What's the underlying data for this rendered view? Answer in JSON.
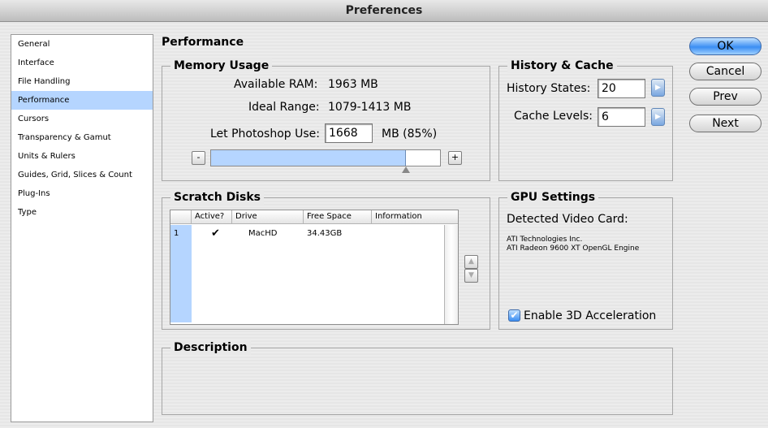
{
  "window": {
    "title": "Preferences"
  },
  "sidebar": {
    "items": [
      {
        "label": "General"
      },
      {
        "label": "Interface"
      },
      {
        "label": "File Handling"
      },
      {
        "label": "Performance"
      },
      {
        "label": "Cursors"
      },
      {
        "label": "Transparency & Gamut"
      },
      {
        "label": "Units & Rulers"
      },
      {
        "label": "Guides, Grid, Slices & Count"
      },
      {
        "label": "Plug-Ins"
      },
      {
        "label": "Type"
      }
    ],
    "selected": "Performance"
  },
  "page": {
    "title": "Performance"
  },
  "memory": {
    "title": "Memory Usage",
    "available_label": "Available RAM:",
    "available_value": "1963 MB",
    "ideal_label": "Ideal Range:",
    "ideal_value": "1079-1413 MB",
    "let_use_label": "Let Photoshop Use:",
    "let_use_value": "1668",
    "unit_suffix": "MB (85%)",
    "slider_fraction": 0.85,
    "minus": "-",
    "plus": "+"
  },
  "history": {
    "title": "History & Cache",
    "states_label": "History States:",
    "states_value": "20",
    "cache_label": "Cache Levels:",
    "cache_value": "6"
  },
  "scratch": {
    "title": "Scratch Disks",
    "columns": [
      "Active?",
      "Drive",
      "Free Space",
      "Information"
    ],
    "rows": [
      {
        "index": "1",
        "active": "✔",
        "drive": "MacHD",
        "free": "34.43GB",
        "info": ""
      }
    ]
  },
  "gpu": {
    "title": "GPU Settings",
    "detected_label": "Detected Video Card:",
    "vendor": "ATI Technologies Inc.",
    "card": "ATI Radeon 9600 XT OpenGL Engine",
    "accel_label": "Enable 3D Acceleration",
    "accel_checked": true
  },
  "description": {
    "title": "Description"
  },
  "buttons": {
    "ok": "OK",
    "cancel": "Cancel",
    "prev": "Prev",
    "next": "Next"
  },
  "colors": {
    "accent": "#3b8ef3",
    "selection": "#b5d5ff",
    "slider_fill": "#b5d5ff"
  }
}
